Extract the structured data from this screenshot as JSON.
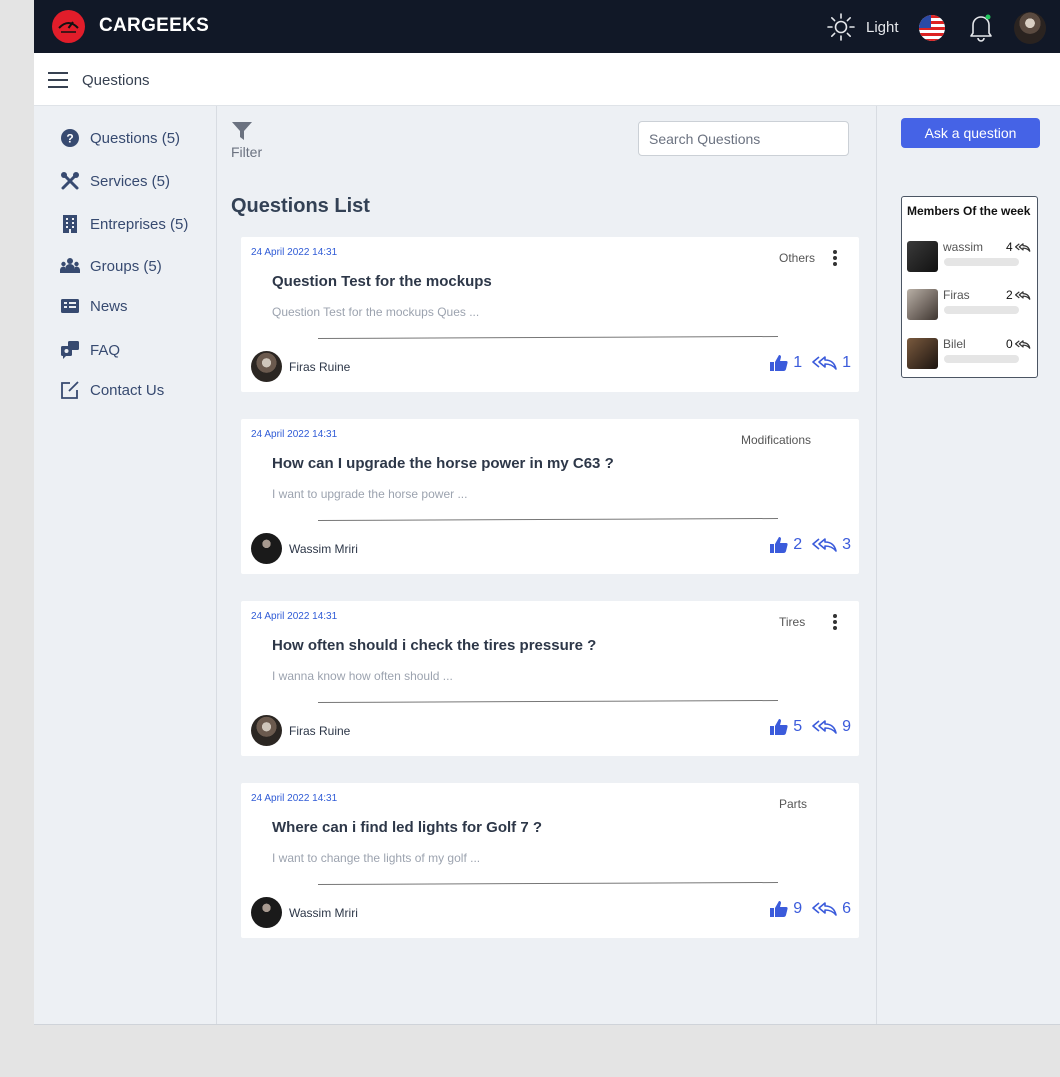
{
  "app": {
    "brand": "CARGEEKS",
    "theme_label": "Light"
  },
  "header": {
    "page_title": "Questions"
  },
  "sidebar": {
    "items": [
      {
        "label": "Questions (5)",
        "icon": "question-circle-icon"
      },
      {
        "label": "Services (5)",
        "icon": "tools-icon"
      },
      {
        "label": "Entreprises (5)",
        "icon": "building-icon"
      },
      {
        "label": "Groups (5)",
        "icon": "group-icon"
      },
      {
        "label": "News",
        "icon": "news-icon"
      },
      {
        "label": "FAQ",
        "icon": "faq-chat-icon"
      },
      {
        "label": "Contact Us",
        "icon": "edit-contact-icon"
      }
    ]
  },
  "main": {
    "filter_label": "Filter",
    "search_placeholder": "Search Questions",
    "list_title": "Questions List",
    "questions": [
      {
        "date": "24 April 2022 14:31",
        "category": "Others",
        "title": "Question Test for the mockups",
        "excerpt": "Question Test for the mockups Ques ...",
        "author": "Firas Ruine",
        "likes": "1",
        "replies": "1",
        "has_menu": true
      },
      {
        "date": "24 April 2022 14:31",
        "category": "Modifications",
        "title": "How can I upgrade the horse power in my C63 ?",
        "excerpt": "I want to upgrade the horse power ...",
        "author": "Wassim Mriri",
        "likes": "2",
        "replies": "3",
        "has_menu": false
      },
      {
        "date": "24 April 2022 14:31",
        "category": "Tires",
        "title": "How often should i check the tires pressure ?",
        "excerpt": "I wanna know how often should ...",
        "author": "Firas Ruine",
        "likes": "5",
        "replies": "9",
        "has_menu": true
      },
      {
        "date": "24 April 2022 14:31",
        "category": "Parts",
        "title": "Where can i find led lights for Golf 7 ?",
        "excerpt": "I want to change the lights of my golf ...",
        "author": "Wassim Mriri",
        "likes": "9",
        "replies": "6",
        "has_menu": false
      }
    ]
  },
  "right_panel": {
    "ask_button": "Ask a question",
    "members_title": "Members Of the week",
    "members": [
      {
        "name": "wassim",
        "score": "4"
      },
      {
        "name": "Firas",
        "score": "2"
      },
      {
        "name": "Bilel",
        "score": "0"
      }
    ]
  },
  "colors": {
    "topbar": "#111827",
    "accent": "#4563e6",
    "brand_red": "#e11d2a",
    "link_blue": "#3b5bdb"
  }
}
